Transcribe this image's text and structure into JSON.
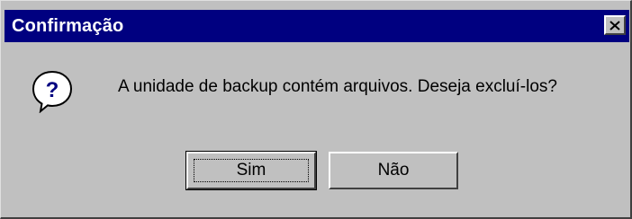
{
  "window": {
    "title": "Confirmação",
    "close_label": "✕"
  },
  "dialog": {
    "icon": "question-icon",
    "message": "A unidade de backup contém arquivos. Deseja excluí-los?"
  },
  "buttons": {
    "yes_label": "Sim",
    "no_label": "Não"
  },
  "colors": {
    "titlebar": "#000080",
    "face": "#c0c0c0",
    "icon_fill": "#ffffff",
    "icon_glyph": "#000080"
  }
}
